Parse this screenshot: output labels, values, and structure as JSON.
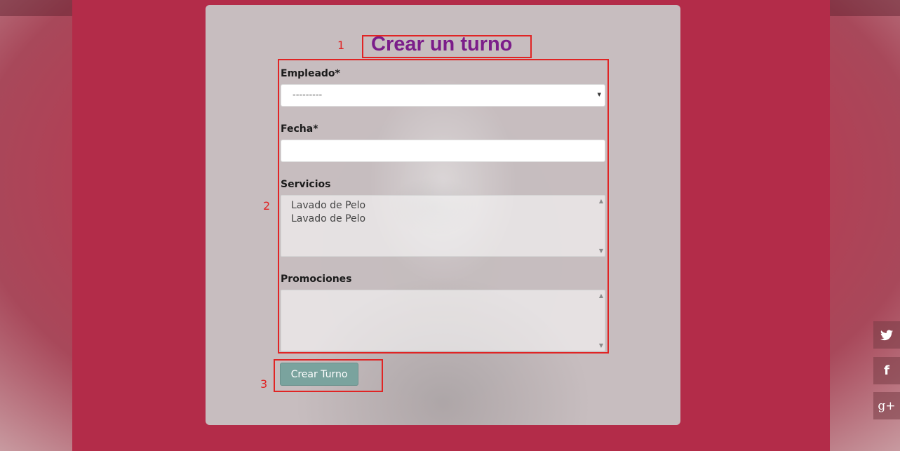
{
  "form": {
    "title": "Crear un turno",
    "fields": {
      "empleado_label": "Empleado*",
      "empleado_value": "---------",
      "fecha_label": "Fecha*",
      "fecha_value": "",
      "servicios_label": "Servicios",
      "servicios_options": [
        "Lavado de Pelo",
        "Lavado de Pelo"
      ],
      "promociones_label": "Promociones"
    },
    "submit_label": "Crear Turno"
  },
  "annotations": [
    "1",
    "2",
    "3"
  ],
  "social": {
    "twitter_glyph": "",
    "facebook_glyph": "f",
    "googleplus_glyph": "g+"
  },
  "colors": {
    "title": "#7b1d8a",
    "annotation": "#e02424",
    "button": "#7aa39e",
    "band": "#b32c49"
  },
  "icons": [
    "select-arrow-icon",
    "scroll-up-icon",
    "scroll-down-icon",
    "twitter-icon",
    "facebook-icon",
    "google-plus-icon"
  ]
}
